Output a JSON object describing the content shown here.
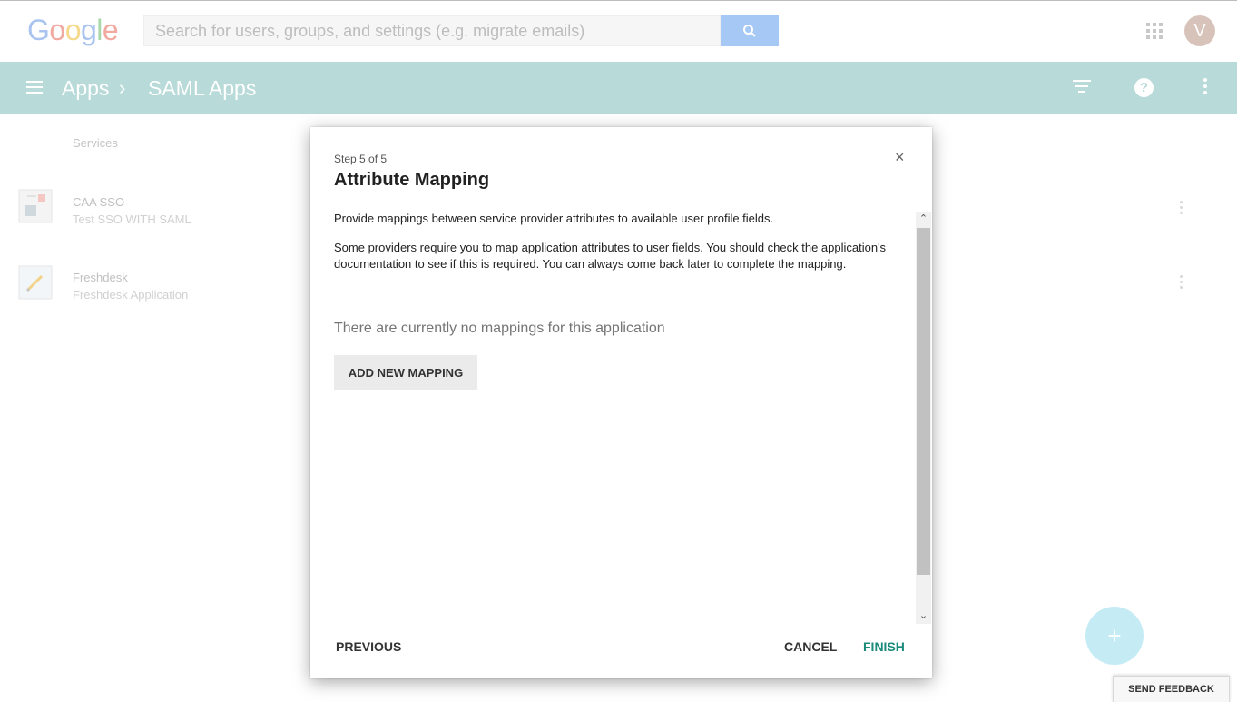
{
  "header": {
    "logo_letters": [
      {
        "char": "G",
        "color": "#a9c4f0"
      },
      {
        "char": "o",
        "color": "#f2a9a0"
      },
      {
        "char": "o",
        "color": "#f6d98c"
      },
      {
        "char": "g",
        "color": "#a9c4f0"
      },
      {
        "char": "l",
        "color": "#a8d8a8"
      },
      {
        "char": "e",
        "color": "#f2a9a0"
      }
    ],
    "search_placeholder": "Search for users, groups, and settings (e.g. migrate emails)",
    "avatar_initial": "V"
  },
  "appbar": {
    "crumb_apps": "Apps",
    "crumb_separator": "›",
    "crumb_current": "SAML Apps",
    "help_glyph": "?"
  },
  "list": {
    "services_label": "Services",
    "apps": [
      {
        "name": "CAA SSO",
        "description": "Test SSO WITH SAML",
        "icon": "saml-app-icon"
      },
      {
        "name": "Freshdesk",
        "description": "Freshdesk Application",
        "icon": "freshdesk-icon"
      }
    ]
  },
  "dialog": {
    "step": "Step 5 of 5",
    "title": "Attribute Mapping",
    "intro": "Provide mappings between service provider attributes to available user profile fields.",
    "details": "Some providers require you to map application attributes to user fields. You should check the application's documentation to see if this is required. You can always come back later to complete the mapping.",
    "empty_message": "There are currently no mappings for this application",
    "add_button": "ADD NEW MAPPING",
    "previous_button": "PREVIOUS",
    "cancel_button": "CANCEL",
    "finish_button": "FINISH",
    "close_glyph": "×"
  },
  "fab_glyph": "+",
  "feedback_button": "SEND FEEDBACK",
  "colors": {
    "appbar": "#b8dad8",
    "finish": "#1a8a7a",
    "search_button": "#a6c8f5"
  }
}
